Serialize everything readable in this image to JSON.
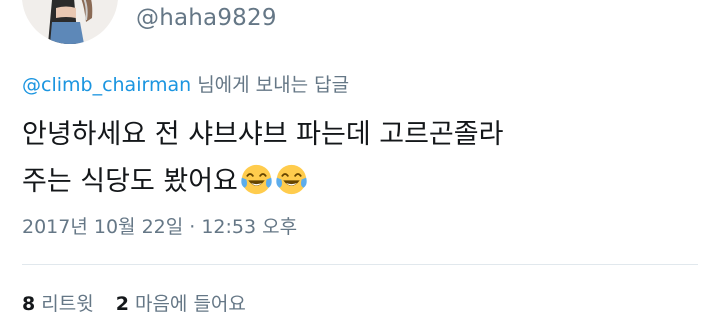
{
  "tweet": {
    "handle": "@haha9829",
    "reply": {
      "mention": "@climb_chairman",
      "suffix": " 님에게 보내는 답글"
    },
    "text_line1": "안녕하세요 전 샤브샤브 파는데 고르곤졸라",
    "text_line2": "주는 식당도 봤어요",
    "emojis": [
      "face-with-tears-of-joy-icon",
      "face-with-tears-of-joy-icon"
    ],
    "timestamp": "2017년 10월 22일 · 12:53 오후",
    "retweets": {
      "count": "8",
      "label": "리트윗"
    },
    "likes": {
      "count": "2",
      "label": "마음에 들어요"
    }
  },
  "colors": {
    "text": "#14171a",
    "secondary": "#657786",
    "link": "#1b95e0",
    "divider": "#e1e8ed",
    "emoji_face": "#ffcc4d"
  }
}
